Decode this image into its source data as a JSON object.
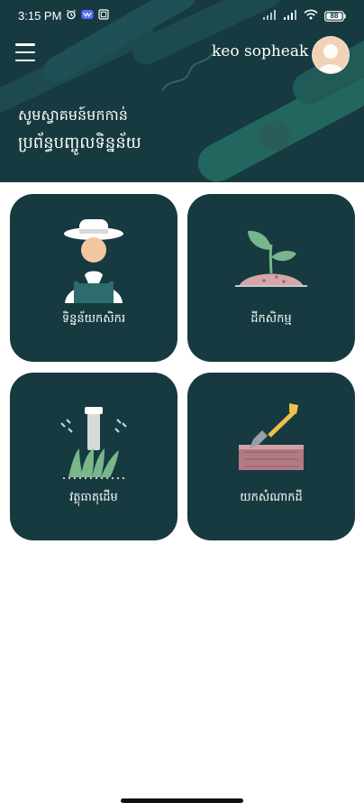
{
  "status_bar": {
    "time": "3:15 PM",
    "left_icons": [
      "alarm-icon",
      "notification-app-icon",
      "sim-card-icon"
    ],
    "right_icons": [
      "signal-bars-icon",
      "signal-bars-icon",
      "wifi-icon",
      "battery-icon"
    ],
    "battery": "88"
  },
  "header": {
    "user_name": "keo sopheak",
    "welcome_text": "សូមស្វាគមន៍មកកាន់",
    "system_title": "ប្រព័ន្ធបញ្ចូលទិន្នន័យ",
    "colors": {
      "background": "#163a3f",
      "accent": "#2b6a62"
    }
  },
  "menu": {
    "icon": "menu-icon"
  },
  "cards": [
    {
      "label": "ទិន្នន័យកសិករ",
      "icon": "farmer-icon"
    },
    {
      "label": "ដីកសិកម្ម",
      "icon": "plant-soil-icon"
    },
    {
      "label": "វត្ថុធាតុដើម",
      "icon": "sprinkler-grass-icon"
    },
    {
      "label": "យកសំណាកដី",
      "icon": "shovel-soil-icon"
    }
  ]
}
